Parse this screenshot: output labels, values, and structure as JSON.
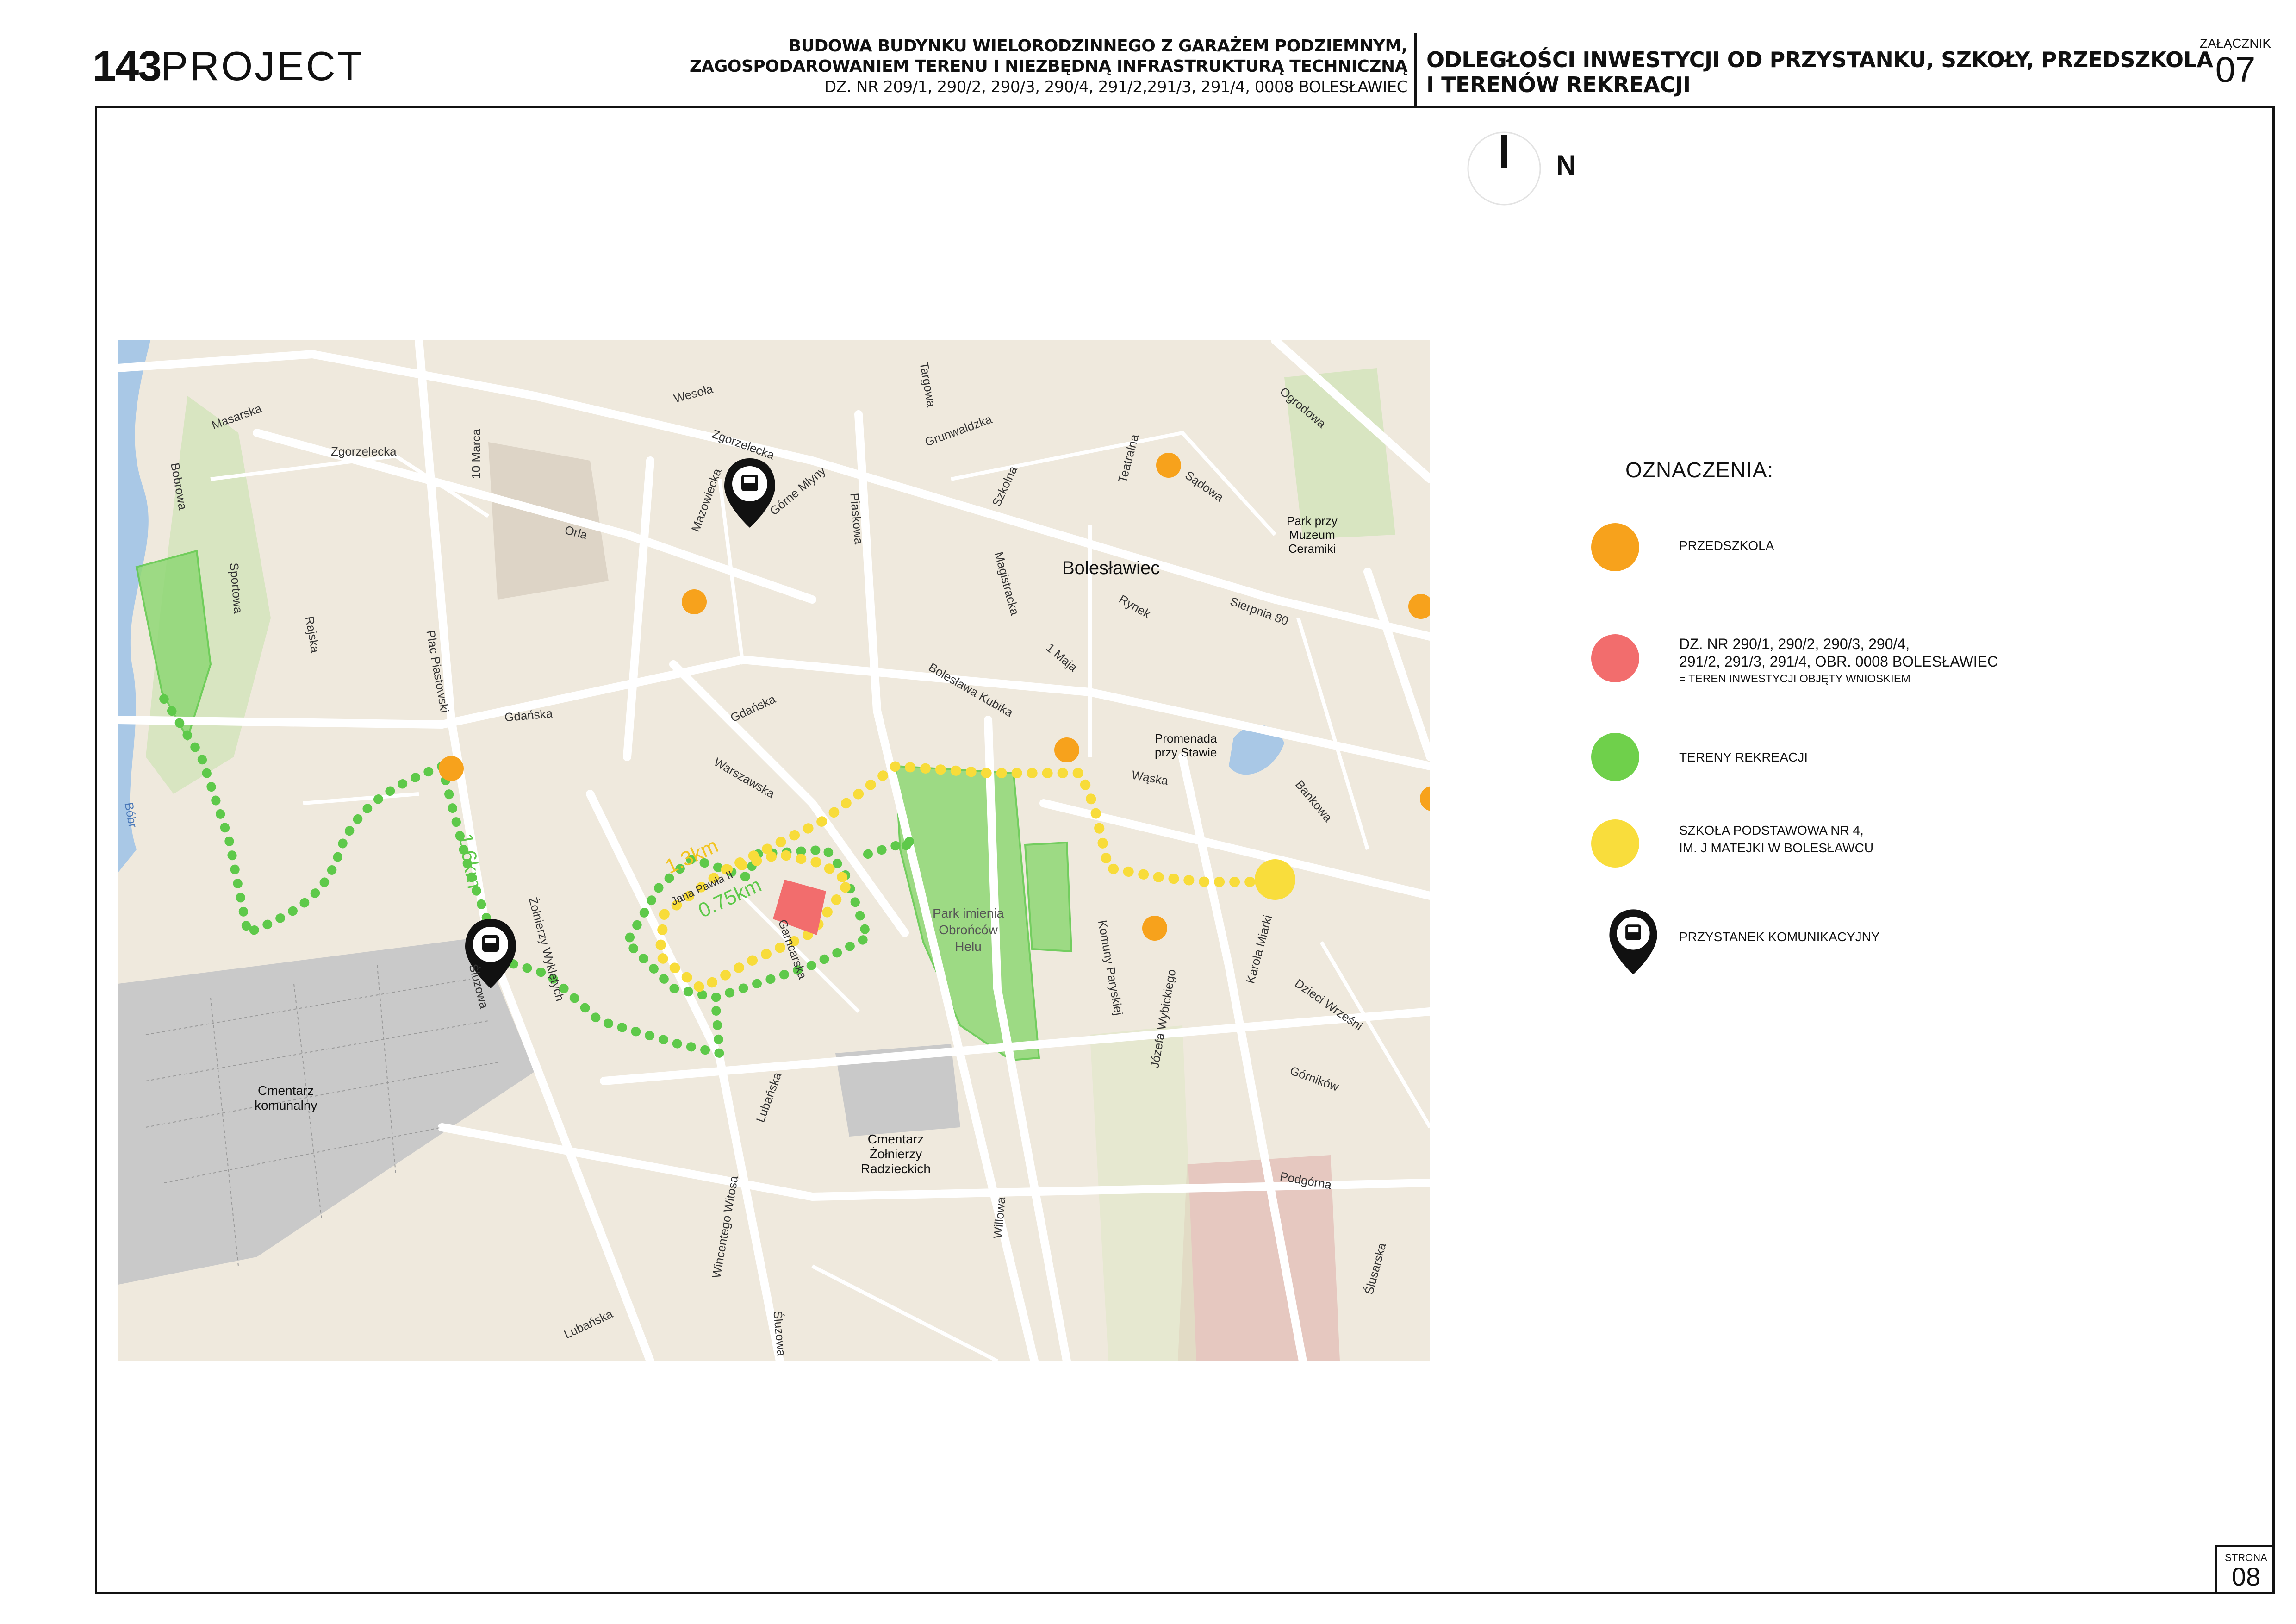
{
  "header": {
    "logo_number": "143",
    "logo_word": "PROJECT",
    "project_line1": "BUDOWA BUDYNKU WIELORODZINNEGO Z GARAŻEM PODZIEMNYM,",
    "project_line2": "ZAGOSPODAROWANIEM TERENU I NIEZBĘDNĄ INFRASTRUKTURĄ TECHNICZNĄ",
    "project_line3": "DZ. NR 209/1, 290/2, 290/3, 290/4, 291/2,291/3, 291/4, 0008 BOLESŁAWIEC",
    "title_line1": "ODLEGŁOŚCI INWESTYCJI OD PRZYSTANKU, SZKOŁY, PRZEDSZKOLA",
    "title_line2": "I TERENÓW  REKREACJI",
    "attachment_label": "ZAŁĄCZNIK",
    "attachment_number": "07"
  },
  "footer": {
    "page_label": "STRONA",
    "page_number": "08"
  },
  "north": {
    "label": "N"
  },
  "legend": {
    "heading": "OZNACZENIA:",
    "items": [
      {
        "color": "#f7a21c",
        "text1": "PRZEDSZKOLA",
        "text2": "",
        "text3": ""
      },
      {
        "color": "#f26d6d",
        "text1": "DZ. NR 290/1, 290/2, 290/3, 290/4,",
        "text2": "291/2, 291/3, 291/4, OBR. 0008 BOLESŁAWIEC",
        "text3": "= TEREN INWESTYCJI OBJĘTY WNIOSKIEM"
      },
      {
        "color": "#6fd04b",
        "text1": "TERENY REKREACJI",
        "text2": "",
        "text3": ""
      },
      {
        "color": "#f9dd3c",
        "text1": "SZKOŁA PODSTAWOWA NR 4,",
        "text2": "IM. J MATEJKI W BOLESŁAWCU",
        "text3": ""
      },
      {
        "icon": "bus-stop-icon",
        "text1": "PRZYSTANEK KOMUNIKACYJNY",
        "text2": "",
        "text3": ""
      }
    ]
  },
  "map": {
    "colors": {
      "land": "#efe9dd",
      "road": "#ffffff",
      "park": "#a7d98a",
      "cemetery": "#c9c9c9",
      "water": "#a9c8e6",
      "route_green": "#5ec94a",
      "route_yellow": "#f8dc3a",
      "investment": "#f26d6d",
      "kindergarten": "#f7a21c"
    },
    "distances": {
      "school": "1.3km",
      "recreation": "0.75km",
      "bus_stop": "1.6km"
    },
    "places": {
      "city": "Bolesławiec",
      "park_helu": [
        "Park imienia",
        "Obrońców",
        "Helu"
      ],
      "cemetery_municipal": [
        "Cmentarz",
        "komunalny"
      ],
      "cemetery_soldiers": [
        "Cmentarz",
        "Żołnierzy",
        "Radzieckich"
      ],
      "promenade": [
        "Promenada",
        "przy Stawie"
      ],
      "museum_park": [
        "Park przy",
        "Muzeum",
        "Ceramiki"
      ]
    },
    "streets": {
      "zgorzelecka1": "Zgorzelecka",
      "zgorzelecka2": "Zgorzelecka",
      "wesola": "Wesoła",
      "masarska": "Masarska",
      "bobrowa": "Bobrowa",
      "dziesiec_marca": "10 Marca",
      "sportowa": "Sportowa",
      "orla": "Orla",
      "mazowiecka": "Mazowiecka",
      "gorne_mlyny": "Górne Młyny",
      "piaskowa": "Piaskowa",
      "targowa": "Targowa",
      "grunwaldzka": "Grunwaldzka",
      "szkolna": "Szkolna",
      "teatralna": "Teatralna",
      "sadowa": "Sądowa",
      "ogrodowa": "Ogrodowa",
      "magistracka": "Magistracka",
      "rynek": "Rynek",
      "sierpnia": "Sierpnia 80",
      "pierwszego_maja": "1 Maja",
      "kubika": "Bolesława Kubika",
      "plac_piastowski": "Plac Piastowski",
      "rajska": "Rajska",
      "gdanska1": "Gdańska",
      "gdanska2": "Gdańska",
      "warszawska": "Warszawska",
      "waska": "Wąska",
      "bankowa": "Bankowa",
      "bobr": "Bóbr",
      "zolnierzy_wykletych": "Żołnierzy Wyklętych",
      "sluzowa1": "Śluzowa",
      "garncarska": "Garncarska",
      "komuny_paryskiej": "Komuny Paryskiej",
      "wybickiego": "Józefa Wybickiego",
      "miarki": "Karola Miarki",
      "dzieci_wrzesni": "Dzieci Wrześni",
      "gornikow": "Górników",
      "podgorna": "Podgórna",
      "lubanska1": "Lubańska",
      "lubanska2": "Lubańska",
      "witosa": "Wincentego Witosa",
      "willowa": "Willowa",
      "sluzowa2": "Śluzowa",
      "slusarska": "Ślusarska",
      "jana_pawla": "Jana Pawła II"
    }
  }
}
